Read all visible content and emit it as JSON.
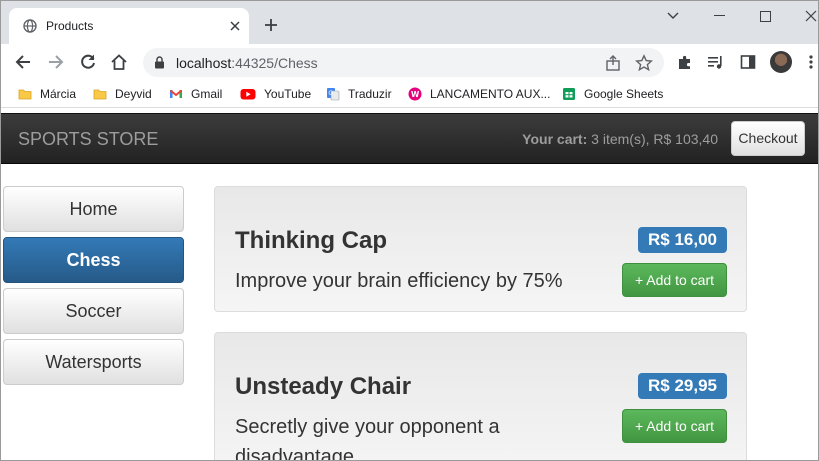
{
  "browser": {
    "tab_title": "Products",
    "url_host": "localhost",
    "url_rest": ":44325/Chess",
    "bookmarks": [
      {
        "label": "Márcia",
        "icon": "folder-icon"
      },
      {
        "label": "Deyvid",
        "icon": "folder-icon"
      },
      {
        "label": "Gmail",
        "icon": "gmail-icon"
      },
      {
        "label": "YouTube",
        "icon": "youtube-icon"
      },
      {
        "label": "Traduzir",
        "icon": "translate-icon"
      },
      {
        "label": "LANCAMENTO AUX...",
        "icon": "app-icon"
      },
      {
        "label": "Google Sheets",
        "icon": "sheets-icon"
      }
    ]
  },
  "store": {
    "brand": "SPORTS STORE",
    "cart_label": "Your cart:",
    "cart_summary": "3 item(s), R$ 103,40",
    "checkout_label": "Checkout",
    "categories": [
      {
        "label": "Home",
        "active": false
      },
      {
        "label": "Chess",
        "active": true
      },
      {
        "label": "Soccer",
        "active": false
      },
      {
        "label": "Watersports",
        "active": false
      }
    ],
    "products": [
      {
        "name": "Thinking Cap",
        "price": "R$ 16,00",
        "description": "Improve your brain efficiency by 75%",
        "add_label": "+ Add to cart"
      },
      {
        "name": "Unsteady Chair",
        "price": "R$ 29,95",
        "description": "Secretly give your opponent a disadvantage",
        "add_label": "+ Add to cart"
      }
    ]
  },
  "colors": {
    "navbar": "#222222",
    "active_category": "#337ab7",
    "price_badge": "#337ab7",
    "add_button": "#5cb85c"
  }
}
